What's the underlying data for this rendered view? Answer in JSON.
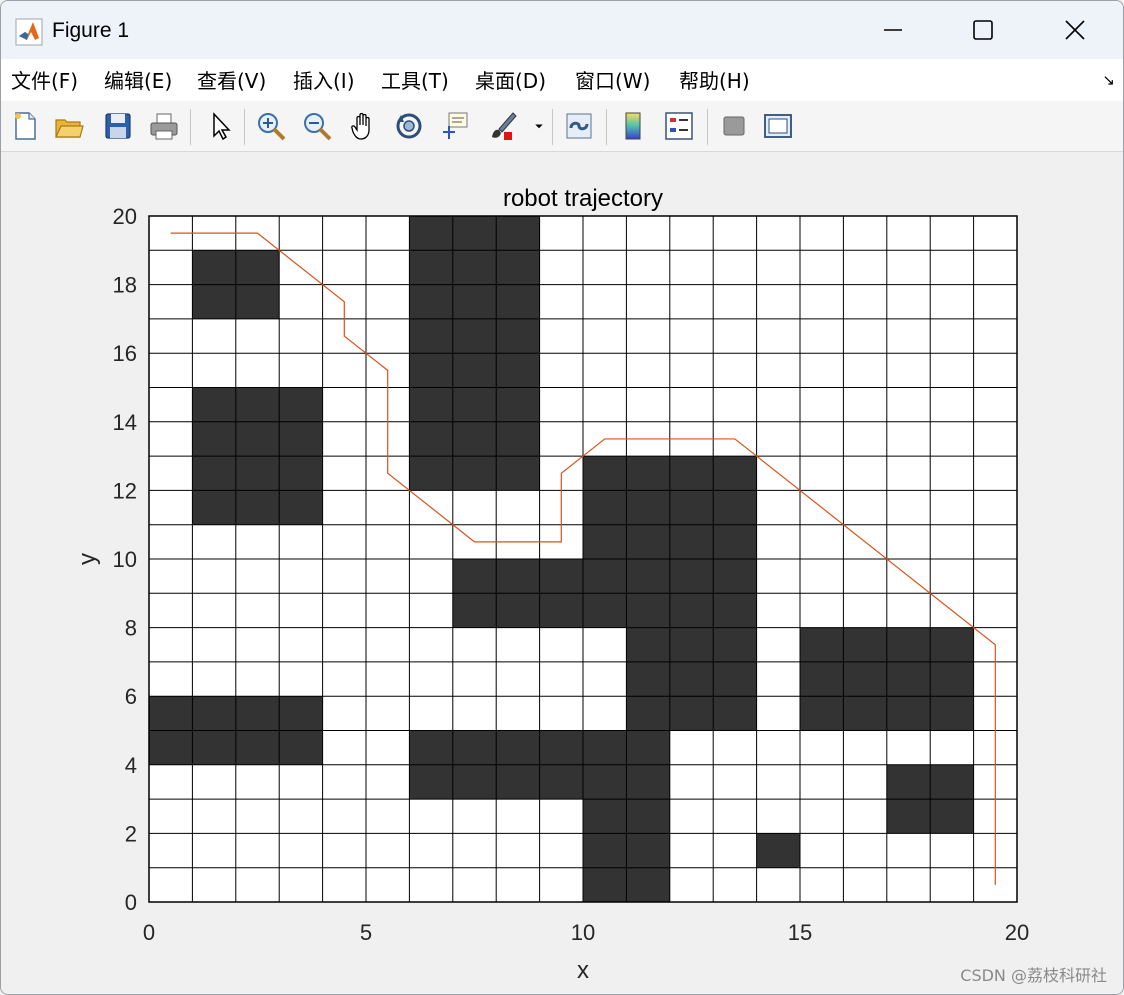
{
  "window": {
    "title": "Figure 1"
  },
  "menu": [
    "文件(F)",
    "编辑(E)",
    "查看(V)",
    "插入(I)",
    "工具(T)",
    "桌面(D)",
    "窗口(W)",
    "帮助(H)"
  ],
  "menu_undock_icon": "undock-arrow-icon",
  "toolbar_icons": [
    "new-figure-icon",
    "open-file-icon",
    "save-icon",
    "print-icon",
    "edit-plot-arrow-icon",
    "zoom-in-icon",
    "zoom-out-icon",
    "pan-hand-icon",
    "rotate-3d-icon",
    "data-cursor-icon",
    "brush-icon",
    "brush-dropdown-icon",
    "link-plot-icon",
    "colorbar-icon",
    "legend-icon",
    "hide-plot-tools-icon",
    "show-plot-tools-icon"
  ],
  "chart_data": {
    "type": "heatmap",
    "title": "robot trajectory",
    "xlabel": "x",
    "ylabel": "y",
    "xlim": [
      0,
      20
    ],
    "ylim": [
      0,
      20
    ],
    "xticks": [
      0,
      5,
      10,
      15,
      20
    ],
    "yticks": [
      0,
      2,
      4,
      6,
      8,
      10,
      12,
      14,
      16,
      18,
      20
    ],
    "grid": "on (unit cells)",
    "cell_colors": {
      "obstacle": "#333333",
      "free": "#ffffff",
      "path": "#d95319"
    },
    "obstacle_rows_top_to_bottom": [
      "00000011100000000000",
      "01100011100000000000",
      "01100011100000000000",
      "00000011100000000000",
      "00000011100000000000",
      "01110011100000000000",
      "01110011100000000000",
      "01110011101111000000",
      "01110000001111000000",
      "00000000001111000000",
      "00000001111111000000",
      "00000001111111000000",
      "00000000000111011110",
      "00000000000111011110",
      "11110000000111011110",
      "11110011111100000000",
      "00000011111100000110",
      "00000000001100000110",
      "00000000001100100000",
      "00000000001100000000"
    ],
    "series": [
      {
        "values": [
          [
            0.5,
            19.5
          ],
          [
            2.5,
            19.5
          ],
          [
            4.5,
            17.5
          ],
          [
            4.5,
            16.5
          ],
          [
            5.5,
            15.5
          ],
          [
            5.5,
            12.5
          ],
          [
            7.5,
            10.5
          ],
          [
            9.5,
            10.5
          ],
          [
            9.5,
            12.5
          ],
          [
            10.5,
            13.5
          ],
          [
            13.5,
            13.5
          ],
          [
            19.5,
            7.5
          ],
          [
            19.5,
            0.5
          ]
        ]
      }
    ]
  },
  "watermark": "CSDN @荔枝科研社"
}
